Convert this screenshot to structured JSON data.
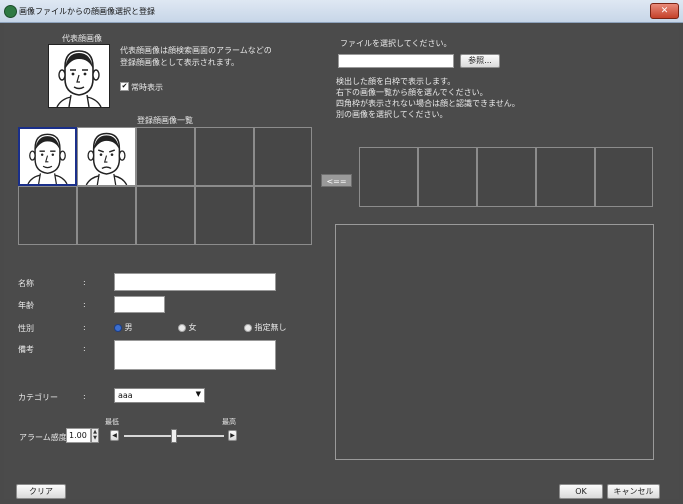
{
  "window": {
    "title": "画像ファイルからの顔画像選択と登録",
    "close_label": "✕"
  },
  "rep_image": {
    "label": "代表顔画像",
    "description_line1": "代表顔画像は顔検索画面のアラームなどの",
    "description_line2": "登録顔画像として表示されます。",
    "always_show_label": "常時表示",
    "always_show_checked": "✔"
  },
  "registered": {
    "label": "登録顔画像一覧"
  },
  "file": {
    "prompt": "ファイルを選択してください。",
    "path_value": "",
    "browse_label": "参照...",
    "help_line1": "検出した顔を白枠で表示します。",
    "help_line2": "右下の画像一覧から顔を選んでください。",
    "help_line3": "四角枠が表示されない場合は顔と認識できません。",
    "help_line4": "別の画像を選択してください。"
  },
  "transfer_button_label": "<==",
  "form": {
    "name_label": "名称",
    "name_colon": ":",
    "name_value": "",
    "age_label": "年齢",
    "age_colon": ":",
    "age_value": "",
    "gender_label": "性別",
    "gender_colon": ":",
    "gender_options": [
      "男",
      "女",
      "指定無し"
    ],
    "gender_selected": "男",
    "notes_label": "備考",
    "notes_colon": ":",
    "notes_value": "",
    "category_label": "カテゴリー",
    "category_colon": ":",
    "category_value": "aaa",
    "alarm_label": "アラーム感度",
    "alarm_value": "1.00",
    "alarm_min_label": "最低",
    "alarm_max_label": "最高",
    "alarm_level": 0.5
  },
  "footer": {
    "clear_label": "クリア",
    "ok_label": "OK",
    "cancel_label": "キャンセル"
  }
}
